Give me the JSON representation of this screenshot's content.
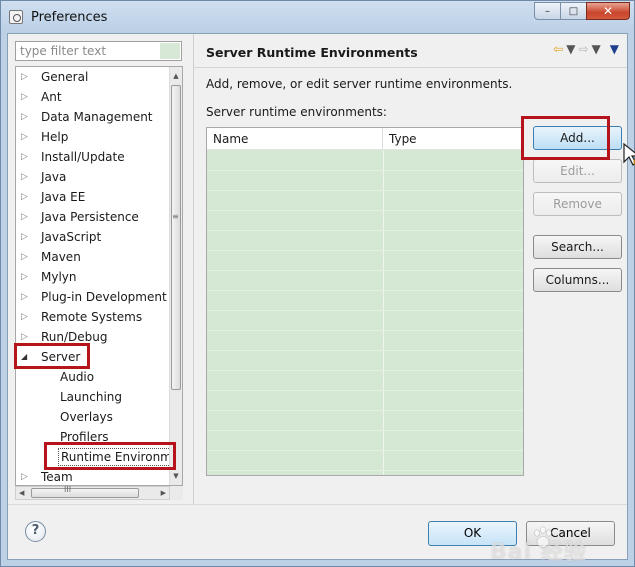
{
  "window": {
    "title": "Preferences",
    "minimize_glyph": "–",
    "maximize_glyph": "□",
    "close_glyph": "✕"
  },
  "filter": {
    "placeholder": "type filter text",
    "value": ""
  },
  "tree": {
    "items": [
      {
        "label": "General",
        "expander": "▷"
      },
      {
        "label": "Ant",
        "expander": "▷"
      },
      {
        "label": "Data Management",
        "expander": "▷"
      },
      {
        "label": "Help",
        "expander": "▷"
      },
      {
        "label": "Install/Update",
        "expander": "▷"
      },
      {
        "label": "Java",
        "expander": "▷"
      },
      {
        "label": "Java EE",
        "expander": "▷"
      },
      {
        "label": "Java Persistence",
        "expander": "▷"
      },
      {
        "label": "JavaScript",
        "expander": "▷"
      },
      {
        "label": "Maven",
        "expander": "▷"
      },
      {
        "label": "Mylyn",
        "expander": "▷"
      },
      {
        "label": "Plug-in Development",
        "expander": "▷"
      },
      {
        "label": "Remote Systems",
        "expander": "▷"
      },
      {
        "label": "Run/Debug",
        "expander": "▷"
      },
      {
        "label": "Server",
        "expander": "◢"
      },
      {
        "label": "Audio"
      },
      {
        "label": "Launching"
      },
      {
        "label": "Overlays"
      },
      {
        "label": "Profilers"
      },
      {
        "label": "Runtime Environm"
      },
      {
        "label": "Team",
        "expander": "▷"
      }
    ],
    "scroll_up": "▲",
    "scroll_down": "▼",
    "scroll_left": "◀",
    "scroll_right": "▶",
    "v_grip": "≡",
    "h_grip": "III"
  },
  "page": {
    "title": "Server Runtime Environments",
    "back_icon": "⇦",
    "forward_icon": "⇨",
    "dropdown_glyph": "▼",
    "menu_glyph": "▼",
    "description": "Add, remove, or edit server runtime environments.",
    "list_label": "Server runtime environments:",
    "columns": {
      "name": "Name",
      "type": "Type"
    }
  },
  "buttons": {
    "add": "Add...",
    "edit": "Edit...",
    "remove": "Remove",
    "search": "Search...",
    "columns": "Columns..."
  },
  "footer": {
    "help": "?",
    "ok": "OK",
    "cancel": "Cancel"
  },
  "watermark": {
    "text": "Bai  经验"
  },
  "colors": {
    "highlight": "#b5141c",
    "table_bg": "#d4e8d4",
    "primary_border": "#3c7fb1"
  }
}
